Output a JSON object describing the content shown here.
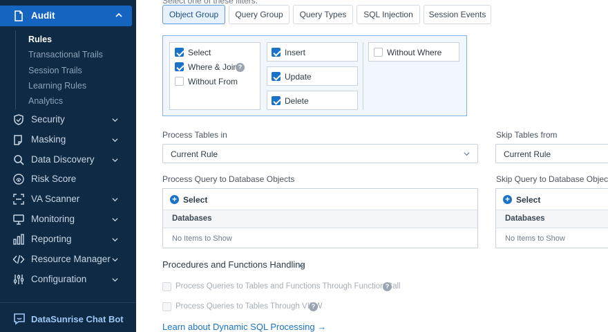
{
  "sidebar": {
    "top_cut_label": "",
    "audit": {
      "label": "Audit",
      "icon": "document-icon"
    },
    "audit_children": [
      {
        "label": "Rules",
        "active": true
      },
      {
        "label": "Transactional Trails"
      },
      {
        "label": "Session Trails"
      },
      {
        "label": "Learning Rules"
      },
      {
        "label": "Analytics"
      }
    ],
    "items": [
      {
        "label": "Security",
        "icon": "shield-icon"
      },
      {
        "label": "Masking",
        "icon": "mask-icon"
      },
      {
        "label": "Data Discovery",
        "icon": "search-icon"
      },
      {
        "label": "Risk Score",
        "icon": "fingerprint-icon"
      },
      {
        "label": "VA Scanner",
        "icon": "scanner-icon"
      },
      {
        "label": "Monitoring",
        "icon": "monitor-icon"
      },
      {
        "label": "Reporting",
        "icon": "bar-chart-icon"
      },
      {
        "label": "Resource Manager",
        "icon": "code-icon"
      },
      {
        "label": "Configuration",
        "icon": "sliders-icon"
      }
    ],
    "bottom_cut_label": "",
    "chatbot": {
      "label": "DataSunrise Chat Bot",
      "icon": "chat-icon"
    }
  },
  "main": {
    "cut_title": "Select one of these filters:",
    "tabs": [
      {
        "label": "Object Group",
        "active": true
      },
      {
        "label": "Query Group"
      },
      {
        "label": "Query Types"
      },
      {
        "label": "SQL Injection"
      },
      {
        "label": "Session Events"
      }
    ],
    "filters": {
      "col1": [
        {
          "label": "Select",
          "checked": true
        },
        {
          "label": "Where & Join",
          "checked": true,
          "help": true
        },
        {
          "label": "Without From",
          "checked": false
        }
      ],
      "col2": [
        {
          "label": "Insert",
          "checked": true
        },
        {
          "label": "Update",
          "checked": true
        },
        {
          "label": "Delete",
          "checked": true
        }
      ],
      "col3": [
        {
          "label": "Without Where",
          "checked": false
        }
      ]
    },
    "process_tables": {
      "label": "Process Tables in",
      "value": "Current Rule"
    },
    "skip_tables": {
      "label": "Skip Tables from",
      "value": "Current Rule"
    },
    "process_query": {
      "label": "Process Query to Database Objects",
      "select_label": "Select",
      "column": "Databases",
      "empty": "No Items to Show"
    },
    "skip_query": {
      "label": "Skip Query to Database Objects",
      "select_label": "Select",
      "column": "Databases",
      "empty": "No Items to Show"
    },
    "procedures": {
      "title": "Procedures and Functions Handling",
      "options": [
        {
          "label": "Process Queries to Tables and Functions Through Function Call"
        },
        {
          "label": "Process Queries to Tables Through VIEW"
        }
      ]
    },
    "learn_link": "Learn about Dynamic SQL Processing →"
  },
  "colors": {
    "sidebar_bg": "#0e2a45",
    "accent": "#1a73c8",
    "active_item": "#1565c0"
  }
}
